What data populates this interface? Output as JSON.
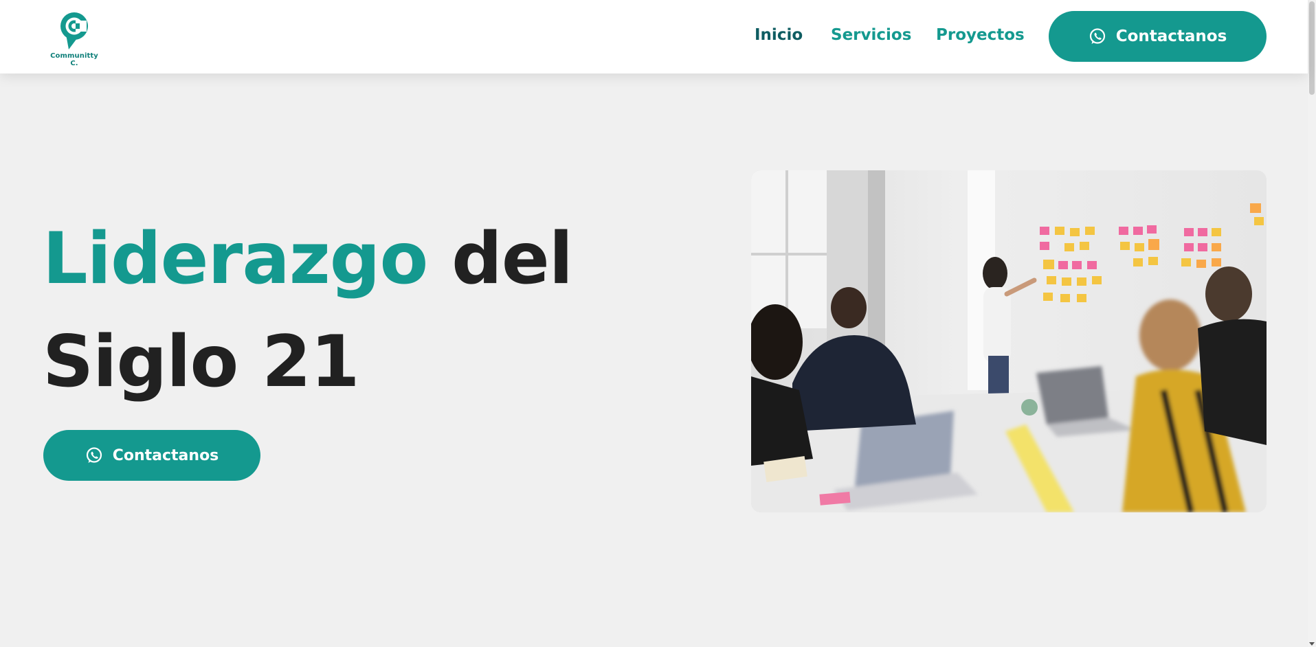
{
  "header": {
    "logo_text": "Communitty C.",
    "nav": [
      {
        "label": "Inicio"
      },
      {
        "label": "Servicios"
      },
      {
        "label": "Proyectos"
      }
    ],
    "cta_label": "Contactanos"
  },
  "hero": {
    "title_accent": "Liderazgo",
    "title_rest": "del",
    "title_line2": "Siglo 21",
    "cta_label": "Contactanos"
  },
  "colors": {
    "accent": "#14998f",
    "nav_active": "#0e5c61",
    "title": "#212121",
    "background": "#f0f0f0"
  },
  "icons": [
    "logo-icon",
    "whatsapp-icon"
  ]
}
